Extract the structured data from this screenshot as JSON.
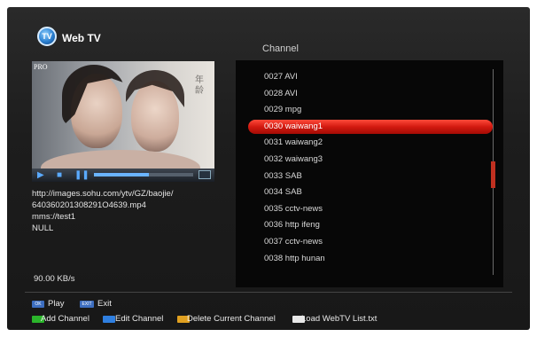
{
  "header": {
    "title": "Web TV",
    "icon_text": "TV"
  },
  "channel_panel": {
    "heading": "Channel",
    "selected_index": 3,
    "items": [
      {
        "num": "0027",
        "name": "AVI"
      },
      {
        "num": "0028",
        "name": "AVI"
      },
      {
        "num": "0029",
        "name": "mpg"
      },
      {
        "num": "0030",
        "name": "waiwang1"
      },
      {
        "num": "0031",
        "name": "waiwang2"
      },
      {
        "num": "0032",
        "name": "waiwang3"
      },
      {
        "num": "0033",
        "name": "SAB"
      },
      {
        "num": "0034",
        "name": "SAB"
      },
      {
        "num": "0035",
        "name": "cctv-news"
      },
      {
        "num": "0036",
        "name": "http ifeng"
      },
      {
        "num": "0037",
        "name": "cctv-news"
      },
      {
        "num": "0038",
        "name": "http hunan"
      }
    ]
  },
  "preview": {
    "brand": "PRO",
    "progress": 0.55,
    "info_lines": [
      "http://images.sohu.com/ytv/GZ/baojie/",
      "640360201308291O4639.mp4",
      "mms://test1",
      "NULL"
    ],
    "speed": "90.00 KB/s"
  },
  "footer": {
    "play_key": "OK",
    "play_label": "Play",
    "exit_key": "EXIT",
    "exit_label": "Exit",
    "color_keys": [
      {
        "color": "#2bb52b",
        "label": "Add Channel"
      },
      {
        "color": "#2f7fe0",
        "label": "Edit Channel"
      },
      {
        "color": "#e0a020",
        "label": "Delete Current Channel"
      },
      {
        "color": "#e8e8e8",
        "label": "Load WebTV List.txt"
      }
    ]
  }
}
